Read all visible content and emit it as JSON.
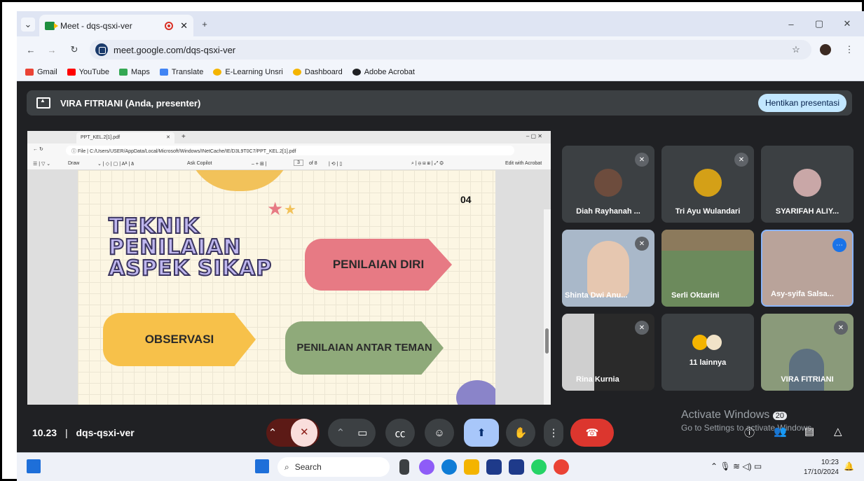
{
  "browser": {
    "tab_title": "Meet - dqs-qsxi-ver",
    "new_tab": "+",
    "url": "meet.google.com/dqs-qsxi-ver",
    "window_controls": [
      "–",
      "▢",
      "✕"
    ]
  },
  "bookmarks": [
    {
      "label": "Gmail",
      "color": "#ea4335"
    },
    {
      "label": "YouTube",
      "color": "#ff0000"
    },
    {
      "label": "Maps",
      "color": "#34a853"
    },
    {
      "label": "Translate",
      "color": "#4285f4"
    },
    {
      "label": "E-Learning Unsri",
      "color": "#f4b400"
    },
    {
      "label": "Dashboard",
      "color": "#f4b400"
    },
    {
      "label": "Adobe Acrobat",
      "color": "#202124"
    }
  ],
  "presenting": {
    "label": "VIRA FITRIANI (Anda, presenter)",
    "stop_button": "Hentikan presentasi"
  },
  "shared_screen": {
    "tab_title": "PPT_KEL.2[1].pdf",
    "file_label": "File",
    "path": "C:/Users/USER/AppData/Local/Microsoft/Windows/INetCache/IE/D3L9T0C7/PPT_KEL.2[1].pdf",
    "toolbar": {
      "draw": "Draw",
      "ask_copilot": "Ask Copilot",
      "page": "3",
      "of_pages": "of 8",
      "edit": "Edit with Acrobat"
    },
    "slide": {
      "number": "04",
      "title_lines": [
        "TEKNIK",
        "PENILAIAN",
        "ASPEK SIKAP"
      ],
      "items": [
        "PENILAIAN DIRI",
        "OBSERVASI",
        "PENILAIAN ANTAR TEMAN"
      ]
    }
  },
  "participants": [
    {
      "name": "Diah Rayhanah ...",
      "muted": true,
      "bg": "#3c4043",
      "avatar": "#6d4c3d"
    },
    {
      "name": "Tri Ayu Wulandari",
      "muted": true,
      "bg": "#3c4043",
      "avatar": "#d4a017"
    },
    {
      "name": "SYARIFAH ALIY...",
      "muted": false,
      "bg": "#3c4043",
      "avatar": "#c9a7a7"
    },
    {
      "name": "Shinta Dwi Anu...",
      "muted": true,
      "bg": "#a9b8c9",
      "avatar": ""
    },
    {
      "name": "Serli Oktarini",
      "muted": true,
      "bg": "#6c8a5c",
      "avatar": ""
    },
    {
      "name": "Asy-syifa Salsa...",
      "muted": false,
      "bg": "#b9a39a",
      "avatar": ""
    },
    {
      "name": "Rina Kurnia",
      "muted": true,
      "bg": "#2a2a2a",
      "avatar": ""
    },
    {
      "name": "11 lainnya",
      "muted": false,
      "bg": "#3c4043",
      "avatar": "#f4b400"
    },
    {
      "name": "VIRA FITRIANI",
      "muted": true,
      "bg": "#8a9a7a",
      "avatar": ""
    }
  ],
  "meeting": {
    "time": "10.23",
    "separator": "|",
    "code": "dqs-qsxi-ver"
  },
  "activate": {
    "title": "Activate Windows",
    "badge": "20",
    "subtitle": "Go to Settings to activate Windows."
  },
  "taskbar": {
    "search": "Search",
    "time": "10:23",
    "date": "17/10/2024"
  }
}
